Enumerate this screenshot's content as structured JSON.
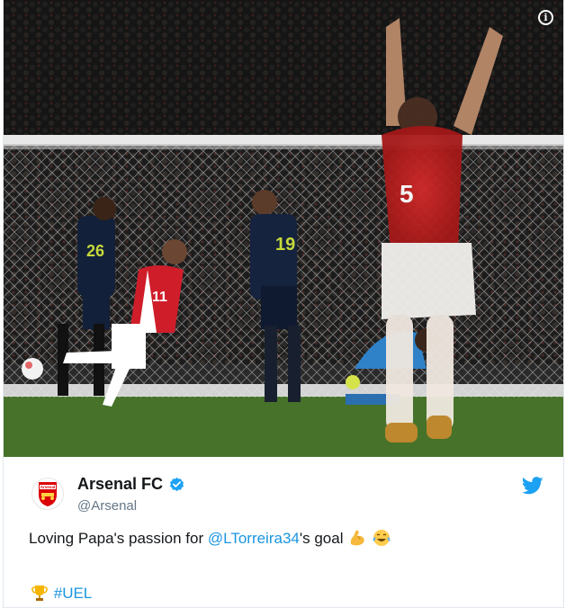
{
  "media": {
    "icon": "info-icon",
    "info_glyph": "i",
    "player_numbers": [
      "19",
      "5",
      "11",
      "26"
    ]
  },
  "tweet": {
    "account_name": "Arsenal FC",
    "handle": "@Arsenal",
    "avatar_label": "Arsenal",
    "text_before": "Loving Papa's passion for ",
    "mention": "@LTorreira34",
    "text_after": "'s goal ",
    "hashtag": "#UEL",
    "emojis": [
      "flexed-biceps-emoji",
      "tears-of-joy-emoji",
      "trophy-emoji"
    ],
    "icons": [
      "verified-badge-icon",
      "twitter-bird-icon"
    ]
  },
  "colors": {
    "link": "#1b95e0",
    "twitter_blue": "#1da1f2",
    "arsenal_red": "#db0007",
    "text": "#14171a",
    "secondary_text": "#657786"
  }
}
